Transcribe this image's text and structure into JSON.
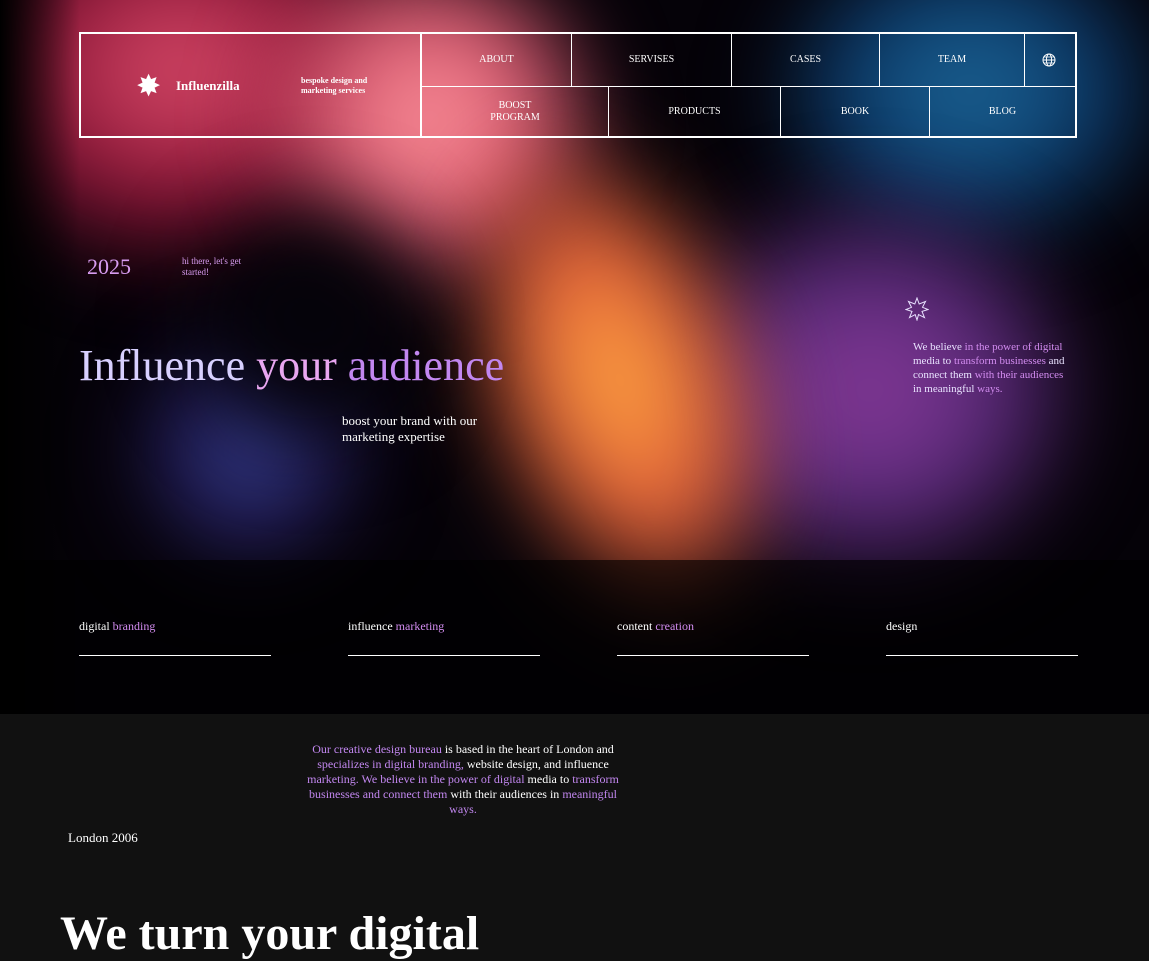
{
  "brand": {
    "name": "Influenzilla",
    "tagline": "bespoke design and marketing services",
    "logo_icon": "starburst-icon"
  },
  "nav": {
    "row1": [
      "ABOUT",
      "SERVISES",
      "CASES",
      "TEAM"
    ],
    "row2": [
      "BOOST PROGRAM",
      "PRODUCTS",
      "BOOK",
      "BLOG"
    ],
    "language_icon": "globe-icon"
  },
  "hero": {
    "year": "2025",
    "greeting": "hi there, let's get started!",
    "headline_word1": "Influence",
    "headline_word2": "your",
    "headline_word3": "audience",
    "subtitle": "boost your brand with our marketing expertise",
    "believe": {
      "a": "We believe ",
      "b": "in the power of digital",
      "c": " media to ",
      "d": "transform businesses",
      "e": " and connect them ",
      "f": "with their audiences",
      "g": " in meaningful ",
      "h": "ways."
    }
  },
  "services": [
    {
      "w1": "digital ",
      "w2": "branding"
    },
    {
      "w1": "influence ",
      "w2": "marketing"
    },
    {
      "w1": "content ",
      "w2": "creation"
    },
    {
      "w1": "design",
      "w2": ""
    }
  ],
  "about": {
    "p1": "Our creative design bureau",
    "p2": " is based in the heart of London and",
    "p3": " specializes in digital branding,",
    "p4": " website design, and influence",
    "p5": " marketing. We believe in the power of digital",
    "p6": " media to",
    "p7": " transform businesses and connect them",
    "p8": " with their audiences in",
    "p9": " meaningful ways."
  },
  "location": "London 2006",
  "section_title": "We turn your digital",
  "colors": {
    "accent": "#c287f0",
    "bg": "#111111"
  }
}
